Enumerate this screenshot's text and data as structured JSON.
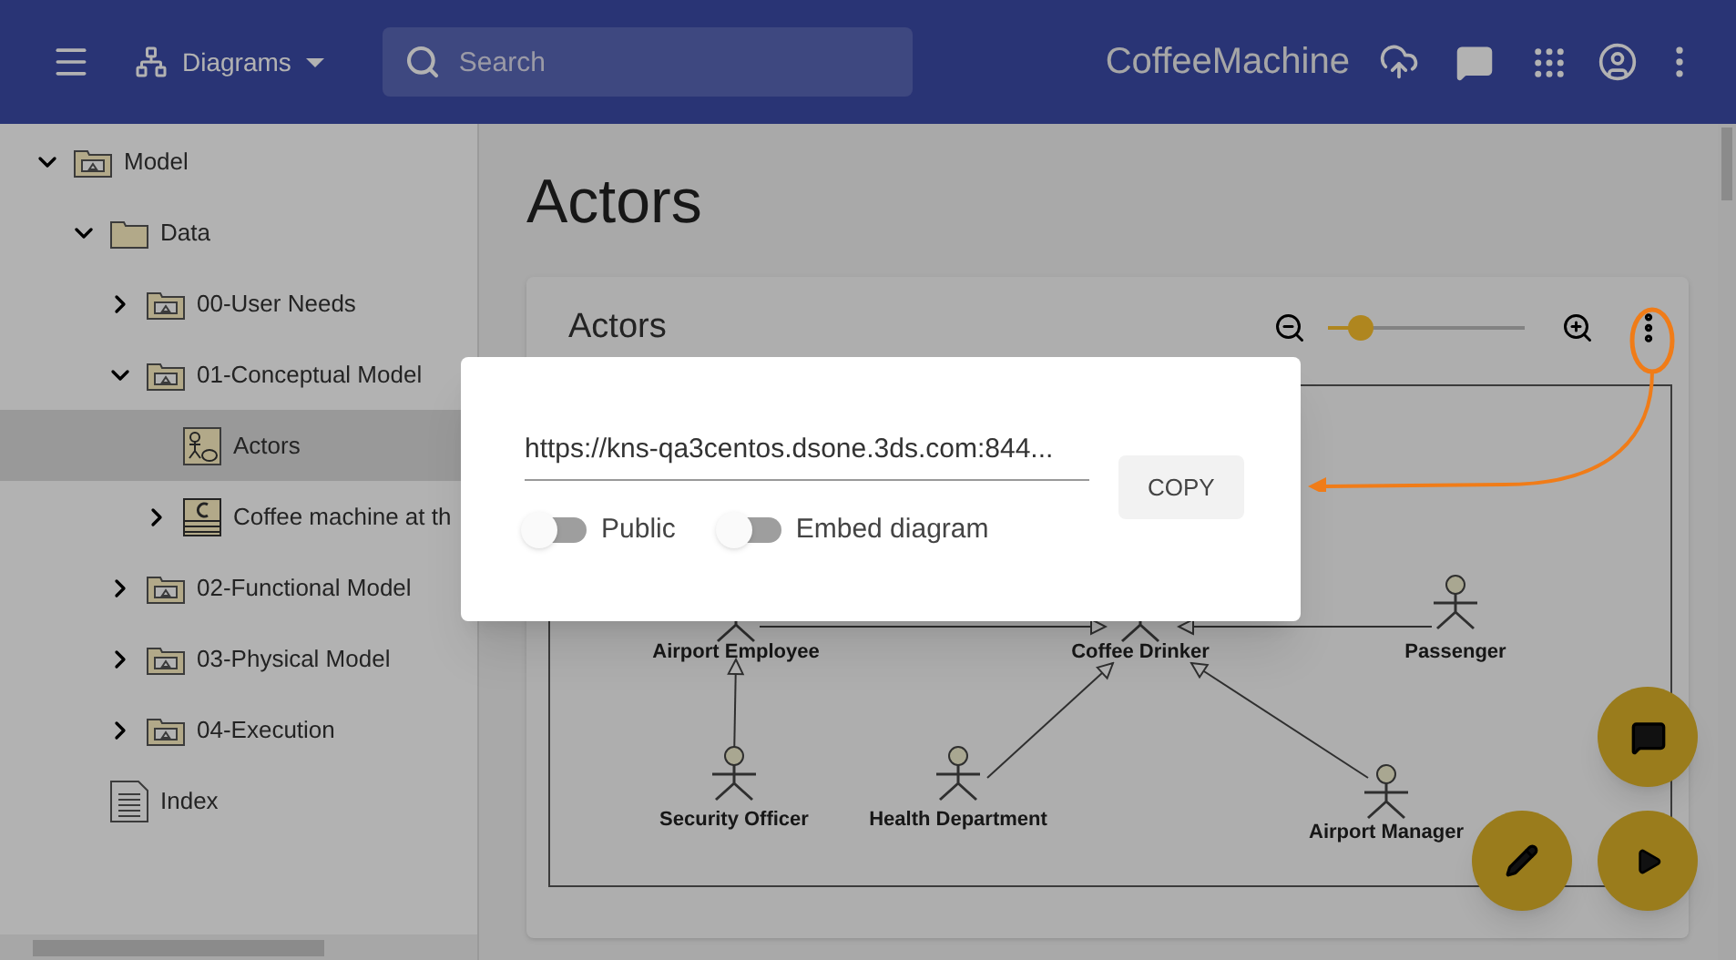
{
  "header": {
    "nav_label": "Diagrams",
    "search": {
      "placeholder": "Search"
    },
    "title": "CoffeeMachine"
  },
  "tree": [
    {
      "label": "Model",
      "kind": "package",
      "expanded": true,
      "selected": false,
      "children": [
        {
          "label": "Data",
          "kind": "folder",
          "expanded": true,
          "selected": false,
          "children": [
            {
              "label": "00-User Needs",
              "kind": "package",
              "expanded": false,
              "selected": false
            },
            {
              "label": "01-Conceptual Model",
              "kind": "package",
              "expanded": true,
              "selected": false,
              "children": [
                {
                  "label": "Actors",
                  "kind": "actor-diagram",
                  "selected": true
                },
                {
                  "label": "Coffee machine at th",
                  "kind": "class-diagram",
                  "expanded": false,
                  "selected": false
                }
              ]
            },
            {
              "label": "02-Functional Model",
              "kind": "package",
              "expanded": false,
              "selected": false
            },
            {
              "label": "03-Physical Model",
              "kind": "package",
              "expanded": false,
              "selected": false
            },
            {
              "label": "04-Execution",
              "kind": "package",
              "expanded": false,
              "selected": false
            }
          ]
        },
        {
          "label": "Index",
          "kind": "index",
          "selected": false
        }
      ]
    }
  ],
  "page_title": "Actors",
  "diagram_card": {
    "title": "Actors",
    "zoom": {
      "level": 0.17
    },
    "actors": [
      {
        "name": "Airport Employee"
      },
      {
        "name": "Coffee Drinker"
      },
      {
        "name": "Passenger"
      },
      {
        "name": "Security Officer"
      },
      {
        "name": "Health Department"
      },
      {
        "name": "Airport Manager"
      }
    ]
  },
  "share_dialog": {
    "url": "https://kns-qa3centos.dsone.3ds.com:844...",
    "button": "COPY",
    "toggles": [
      {
        "label": "Public",
        "on": false
      },
      {
        "label": "Embed diagram",
        "on": false
      }
    ]
  }
}
